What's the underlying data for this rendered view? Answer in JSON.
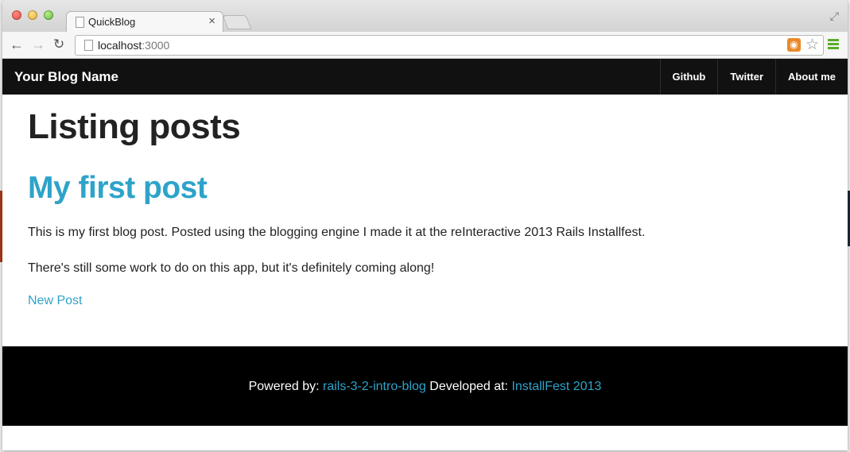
{
  "browser": {
    "tab_title": "QuickBlog",
    "tab_close": "×",
    "url_host": "localhost",
    "url_port": ":3000",
    "back_glyph": "←",
    "forward_glyph": "→",
    "reload_glyph": "↻",
    "expand_glyph": "⤢",
    "rss_glyph": "◉",
    "star_glyph": "☆"
  },
  "navbar": {
    "brand": "Your Blog Name",
    "links": [
      {
        "label": "Github"
      },
      {
        "label": "Twitter"
      },
      {
        "label": "About me"
      }
    ]
  },
  "main": {
    "heading": "Listing posts",
    "post": {
      "title": "My first post",
      "paragraphs": [
        "This is my first blog post. Posted using the blogging engine I made it at the reInteractive 2013 Rails Installfest.",
        "There's still some work to do on this app, but it's definitely coming along!"
      ]
    },
    "new_post_link": "New Post"
  },
  "footer": {
    "powered_prefix": "Powered by: ",
    "powered_link": "rails-3-2-intro-blog",
    "developed_prefix": " Developed at: ",
    "developed_link": "InstallFest 2013"
  },
  "colors": {
    "accent": "#2ea3c9",
    "navbar_bg": "#111111",
    "footer_bg": "#000000"
  }
}
